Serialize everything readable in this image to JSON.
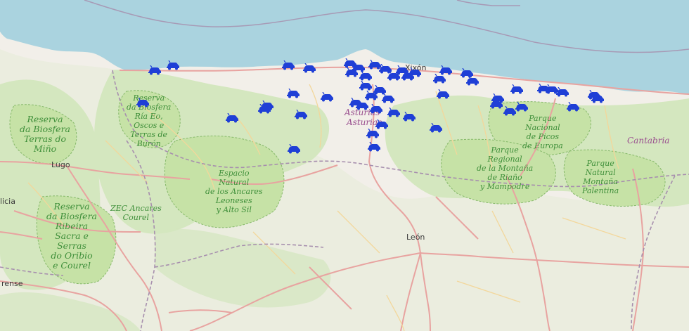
{
  "map": {
    "colors": {
      "sea": "#aad3df",
      "land": "#f2efe9",
      "forest": "#cfe6b8",
      "park": "#c6e2a6",
      "road_major": "#e8a3a0",
      "road_minor": "#f3d79b",
      "boundary": "#a78fae",
      "marker": "#1f3fd6"
    },
    "labels": {
      "reserva_terras": "Reserva\nda Biosfera\nTerras do\nMiño",
      "reserva_oscos": "Reserva\nda Biosfera\nRía Eo,\nOscos e\nTerras de\nBurón",
      "reserva_ribeira": "Reserva\nda Biosfera\nRibeira\nSacra e\nSerras\ndo Oribio\ne Courel",
      "zec_ancares": "ZEC Ancares\nCourel",
      "espacio_ancares": "Espacio\nNatural\nde los Ancares\nLeoneses\ny Alto Sil",
      "picos": "Parque\nNacional\nde Picos\nde Europa",
      "riano": "Parque\nRegional\nde la Montaña\nde Riaño\ny Mampodre",
      "palentina": "Parque\nNatural\nMontaña\nPalentina"
    },
    "cities": {
      "lugo": "Lugo",
      "leon": "León",
      "ourense": "rense",
      "xixon": "Xixón",
      "galicia": "licia"
    },
    "regions": {
      "asturias": "Asturias",
      "cantabria": "Cantabria"
    }
  }
}
